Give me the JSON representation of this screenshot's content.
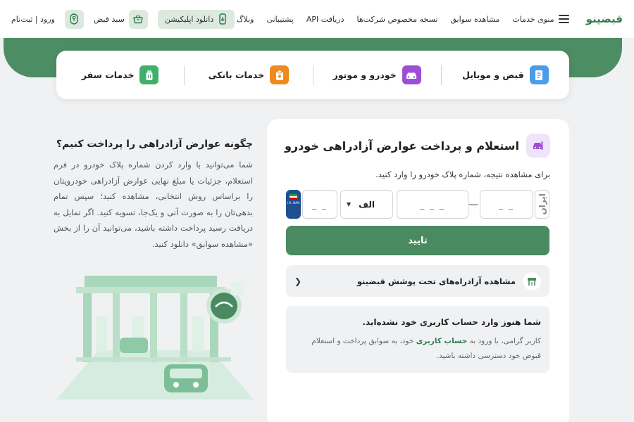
{
  "header": {
    "logo": "قبضینو",
    "menu_label": "منوی خدمات",
    "nav": [
      "مشاهده سوابق",
      "نسخه مخصوص شرکت‌ها",
      "دریافت API",
      "پشتیبانی",
      "وبلاگ"
    ],
    "download_app": "دانلود اپلیکیشن",
    "cart": "سبد قبض",
    "login": "ورود | ثبت‌نام"
  },
  "categories": [
    {
      "label": "قبض و موبایل",
      "icon": "bill-icon",
      "color": "#4a9de8"
    },
    {
      "label": "خودرو و موتور",
      "icon": "car-icon",
      "color": "#9c4fd6"
    },
    {
      "label": "خدمات بانکی",
      "icon": "bank-icon",
      "color": "#f08a1c"
    },
    {
      "label": "خدمات سفر",
      "icon": "luggage-icon",
      "color": "#3fb06a"
    }
  ],
  "card": {
    "title": "استعلام و پرداخت عوارض آزادراهی خودرو",
    "instruction": "برای مشاهده نتیجه، شماره پلاک خودرو را وارد کنید.",
    "plate": {
      "iran_label": "ایران",
      "two_digit_placeholder": "_ _",
      "three_digit_placeholder": "_ _ _",
      "letter_value": "الف",
      "left_two_placeholder": "_ _",
      "flag_text": "I.R. IRAN"
    },
    "submit": "تایید",
    "highways_link": "مشاهده آزادراه‌های تحت پوشش قبضینو",
    "notice_title": "شما هنوز وارد حساب کاربری خود نشده‌اید.",
    "notice_body_pre": "کاربر گرامی، با ورود به ",
    "notice_body_link": "حساب کاربری",
    "notice_body_post": " خود، به سوابق پرداخت و استعلام قبوض خود دسترسی داشته باشید."
  },
  "faq": {
    "title": "چگونه عوارض آزادراهی را پرداخت کنیم؟",
    "body": "شما می‌توانید با وارد کردن شماره پلاک خودرو در فرم استعلام، جزئیات یا مبلغ نهایی عوارض آزادراهی خودرویتان را براساس روش انتخابی، مشاهده کنید؛ سپس تمام بدهی‌تان را به صورت آنی و یک‌جا، تسویه کنید. اگر تمایل به دریافت رسید پرداخت داشته باشید، می‌توانید آن را از بخش «مشاهده سوابق» دانلود کنید."
  },
  "colors": {
    "brand_green": "#4a8a60",
    "light_green": "#dbe9df",
    "background": "#f0f1f3"
  }
}
